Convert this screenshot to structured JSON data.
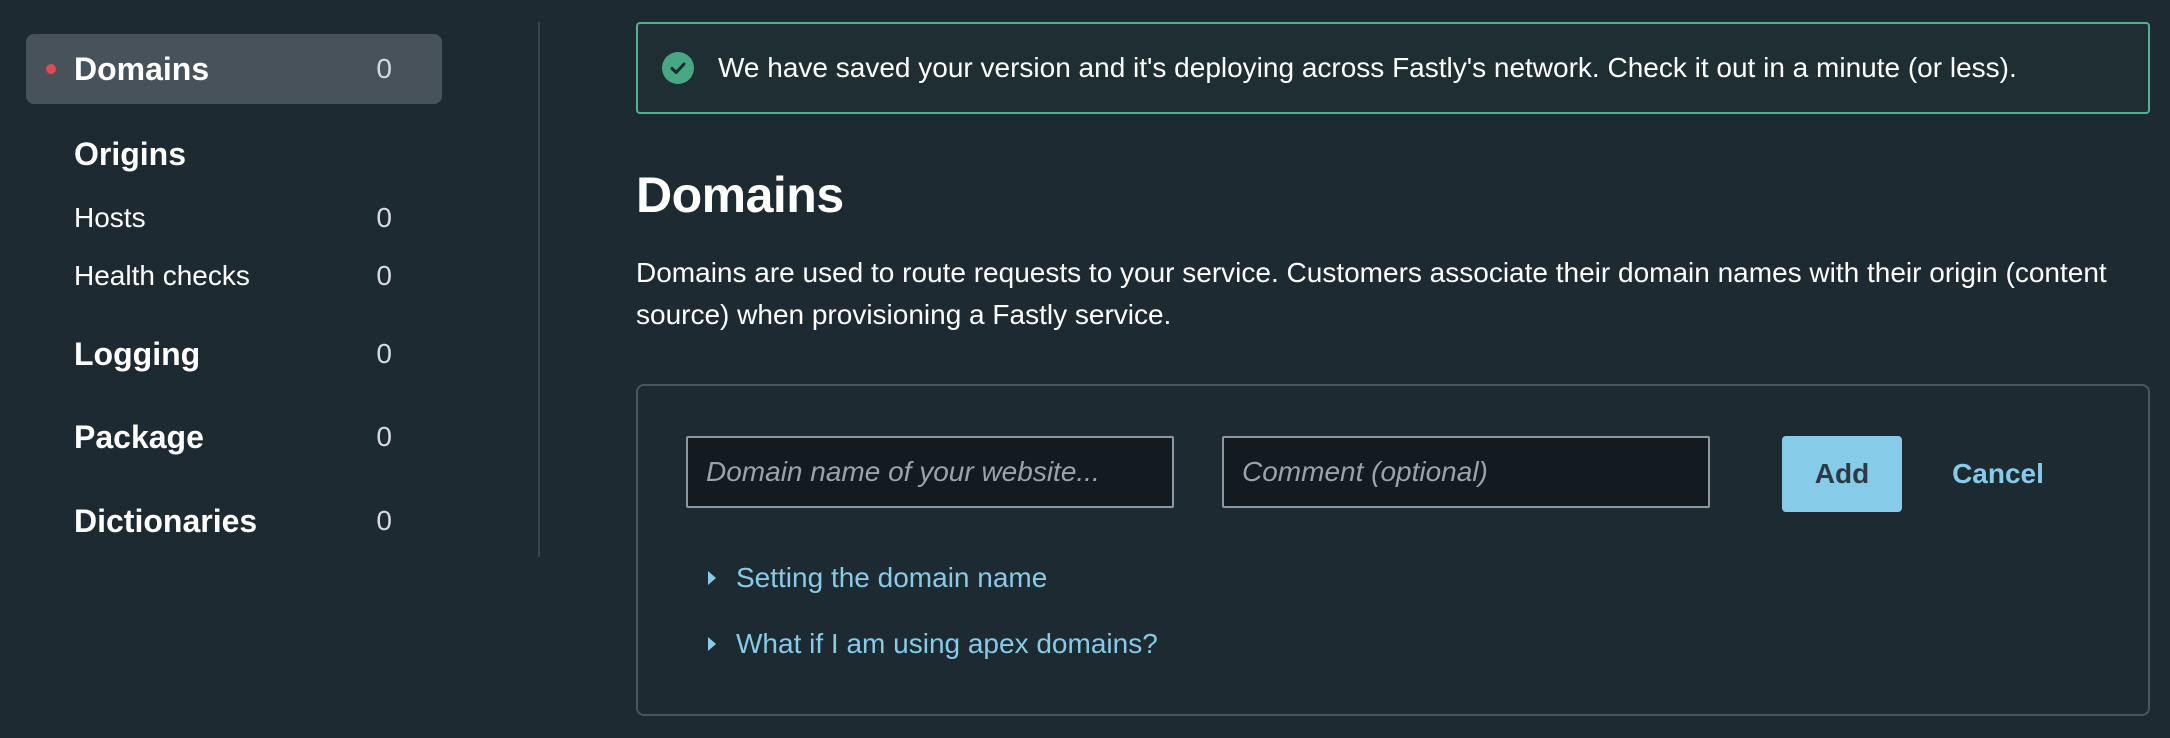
{
  "sidebar": {
    "items": [
      {
        "label": "Domains",
        "count": "0",
        "active": true
      },
      {
        "label": "Origins",
        "count": ""
      },
      {
        "label": "Hosts",
        "count": "0"
      },
      {
        "label": "Health checks",
        "count": "0"
      },
      {
        "label": "Logging",
        "count": "0"
      },
      {
        "label": "Package",
        "count": "0"
      },
      {
        "label": "Dictionaries",
        "count": "0"
      }
    ]
  },
  "alert": {
    "icon": "check-circle-icon",
    "message": "We have saved your version and it's deploying across Fastly's network. Check it out in a minute (or less)."
  },
  "main": {
    "title": "Domains",
    "description": "Domains are used to route requests to your service. Customers associate their domain names with their origin (content source) when provisioning a Fastly service."
  },
  "form": {
    "domain_placeholder": "Domain name of your website...",
    "comment_placeholder": "Comment (optional)",
    "add_label": "Add",
    "cancel_label": "Cancel",
    "help_links": [
      {
        "label": "Setting the domain name"
      },
      {
        "label": "What if I am using apex domains?"
      }
    ]
  },
  "colors": {
    "background": "#1e2a32",
    "accent": "#86cbe8",
    "success": "#48a883",
    "active_dot": "#e5484d"
  }
}
